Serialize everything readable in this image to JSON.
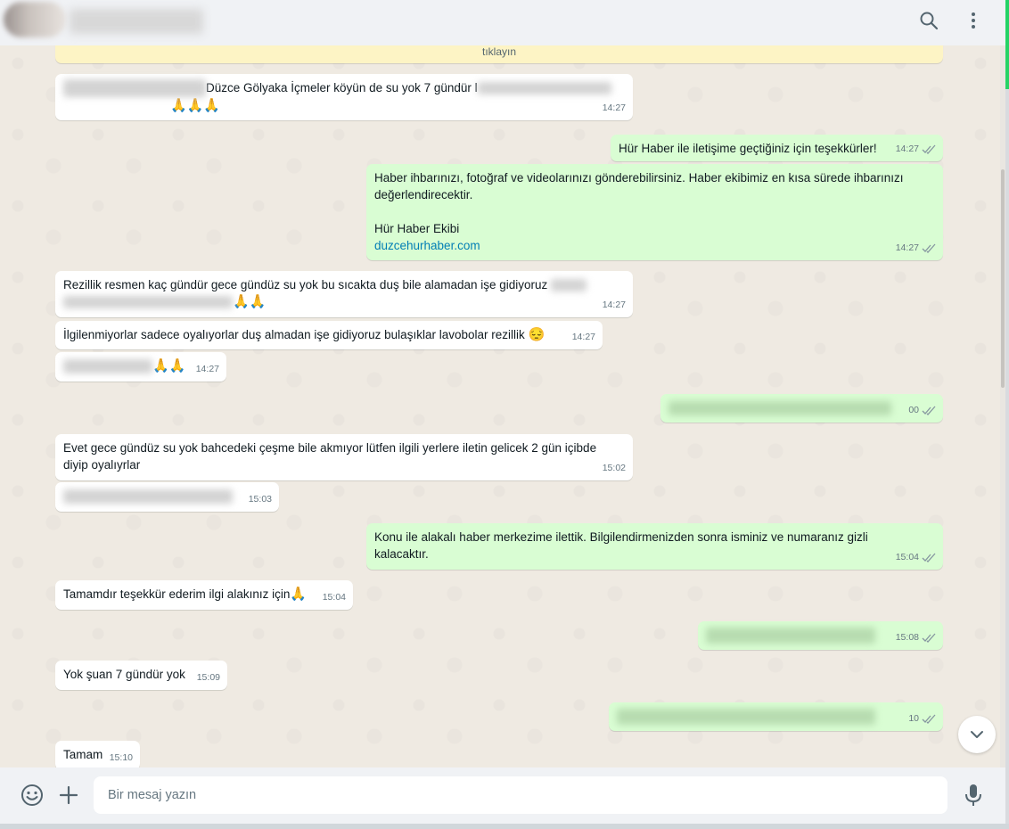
{
  "header": {
    "icons": [
      "search-icon",
      "menu-icon"
    ]
  },
  "notice": {
    "text": "tıklayın"
  },
  "messages": [
    {
      "dir": "in",
      "text": "Düzce Gölyaka İçmeler köyün de su yok 7 gündür l",
      "emoji": "🙏🙏🙏",
      "time": "14:27"
    },
    {
      "dir": "out",
      "text": "Hür Haber ile iletişime geçtiğiniz için teşekkürler!",
      "time": "14:27"
    },
    {
      "dir": "out",
      "line1": "Haber ihbarınızı, fotoğraf ve videolarınızı gönderebilirsiniz. Haber ekibimiz en kısa sürede ihbarınızı",
      "line2": "değerlendirecektir.",
      "signature": "Hür Haber Ekibi",
      "link": "duzcehurhaber.com",
      "time": "14:27"
    },
    {
      "dir": "in",
      "text": "Rezillik resmen kaç gündür gece gündüz su yok bu sıcakta duş bile alamadan işe gidiyoruz",
      "emoji": "🙏🙏",
      "time": "14:27"
    },
    {
      "dir": "in",
      "text": "İlgilenmiyorlar sadece oyalıyorlar duş almadan işe gidiyoruz bulaşıklar lavobolar rezillik",
      "emoji": "😔",
      "time": "14:27"
    },
    {
      "dir": "in",
      "emoji": "🙏🙏",
      "time": "14:27"
    },
    {
      "dir": "out",
      "time": "00"
    },
    {
      "dir": "in",
      "line1": "Evet gece gündüz su yok bahcedeki çeşme bile akmıyor lütfen ilgili yerlere iletin gelicek 2 gün içibde",
      "line2": "diyip oyalıyrlar",
      "time": "15:02"
    },
    {
      "dir": "in",
      "time": "15:03"
    },
    {
      "dir": "out",
      "line1": "Konu ile alakalı haber merkezime ilettik. Bilgilendirmenizden sonra isminiz ve numaranız gizli",
      "line2": "kalacaktır.",
      "time": "15:04"
    },
    {
      "dir": "in",
      "text": "Tamamdır teşekkür ederim ilgi alakınız için",
      "emoji": "🙏",
      "time": "15:04"
    },
    {
      "dir": "out",
      "time": "15:08"
    },
    {
      "dir": "in",
      "text": "Yok şuan 7 gündür yok",
      "time": "15:09"
    },
    {
      "dir": "out",
      "time": "10"
    },
    {
      "dir": "in",
      "text": "Tamam",
      "time": "15:10"
    }
  ],
  "composer": {
    "placeholder": "Bir mesaj yazın"
  },
  "colors": {
    "incoming": "#ffffff",
    "outgoing": "#d9fdd3",
    "accent": "#25d366",
    "link": "#027eb5"
  }
}
